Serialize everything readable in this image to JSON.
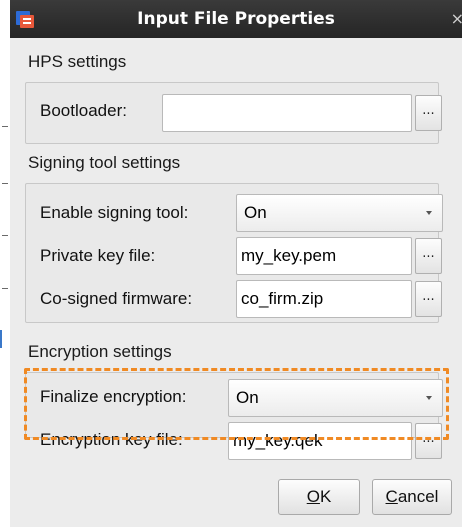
{
  "window": {
    "title": "Input File Properties",
    "close_glyph": "×"
  },
  "hps": {
    "section_label": "HPS settings",
    "bootloader_label": "Bootloader:",
    "bootloader_value": "",
    "browse_label": "..."
  },
  "signing": {
    "section_label": "Signing tool settings",
    "enable_label": "Enable signing tool:",
    "enable_value": "On",
    "private_key_label": "Private key file:",
    "private_key_value": "my_key.pem",
    "cosigned_label": "Co-signed firmware:",
    "cosigned_value": "co_firm.zip",
    "browse_label": "..."
  },
  "encryption": {
    "section_label": "Encryption settings",
    "finalize_label": "Finalize encryption:",
    "finalize_value": "On",
    "key_file_label": "Encryption key file:",
    "key_file_value": "my_key.qek",
    "browse_label": "...",
    "highlight_color": "#f08a24"
  },
  "buttons": {
    "ok_mnemonic": "O",
    "ok_rest": "K",
    "cancel_mnemonic": "C",
    "cancel_rest": "ancel"
  },
  "icons": {
    "app": "app-icon",
    "close": "close-icon",
    "dropdown": "chevron-down-icon"
  }
}
